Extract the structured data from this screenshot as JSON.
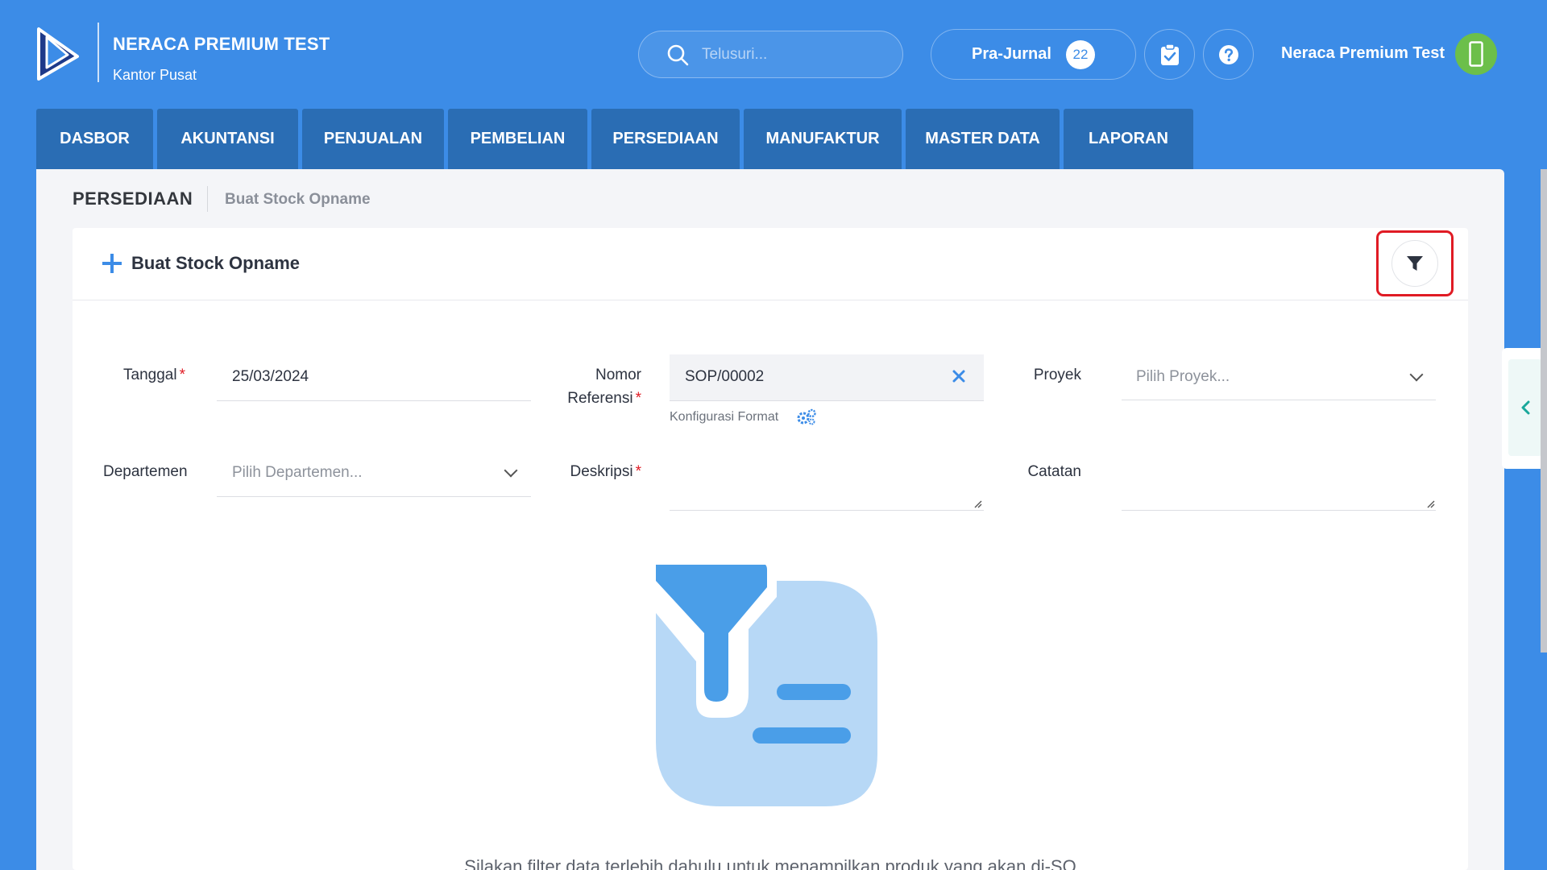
{
  "header": {
    "company_name": "NERACA PREMIUM TEST",
    "company_branch": "Kantor Pusat",
    "search_placeholder": "Telusuri...",
    "pra_jurnal_label": "Pra-Jurnal",
    "pra_jurnal_count": "22",
    "user_name": "Neraca Premium Test"
  },
  "nav": {
    "tabs": [
      "DASBOR",
      "AKUNTANSI",
      "PENJUALAN",
      "PEMBELIAN",
      "PERSEDIAAN",
      "MANUFAKTUR",
      "MASTER DATA",
      "LAPORAN"
    ]
  },
  "breadcrumb": {
    "main": "PERSEDIAAN",
    "sub": "Buat Stock Opname"
  },
  "card": {
    "title": "Buat Stock Opname"
  },
  "form": {
    "tanggal_label": "Tanggal",
    "tanggal_value": "25/03/2024",
    "nomor_label_1": "Nomor",
    "nomor_label_2": "Referensi",
    "nomor_value": "SOP/00002",
    "konfigurasi_label": "Konfigurasi Format",
    "proyek_label": "Proyek",
    "proyek_placeholder": "Pilih Proyek...",
    "departemen_label": "Departemen",
    "departemen_placeholder": "Pilih Departemen...",
    "deskripsi_label": "Deskripsi",
    "catatan_label": "Catatan",
    "required_mark": "*"
  },
  "empty_state": {
    "message": "Silakan filter data terlebih dahulu untuk menampilkan produk yang akan di-SO"
  },
  "colors": {
    "brand_blue": "#3c8ce7",
    "nav_tab": "#2a6db4",
    "required": "#e01b24",
    "highlight": "#e01b24"
  }
}
